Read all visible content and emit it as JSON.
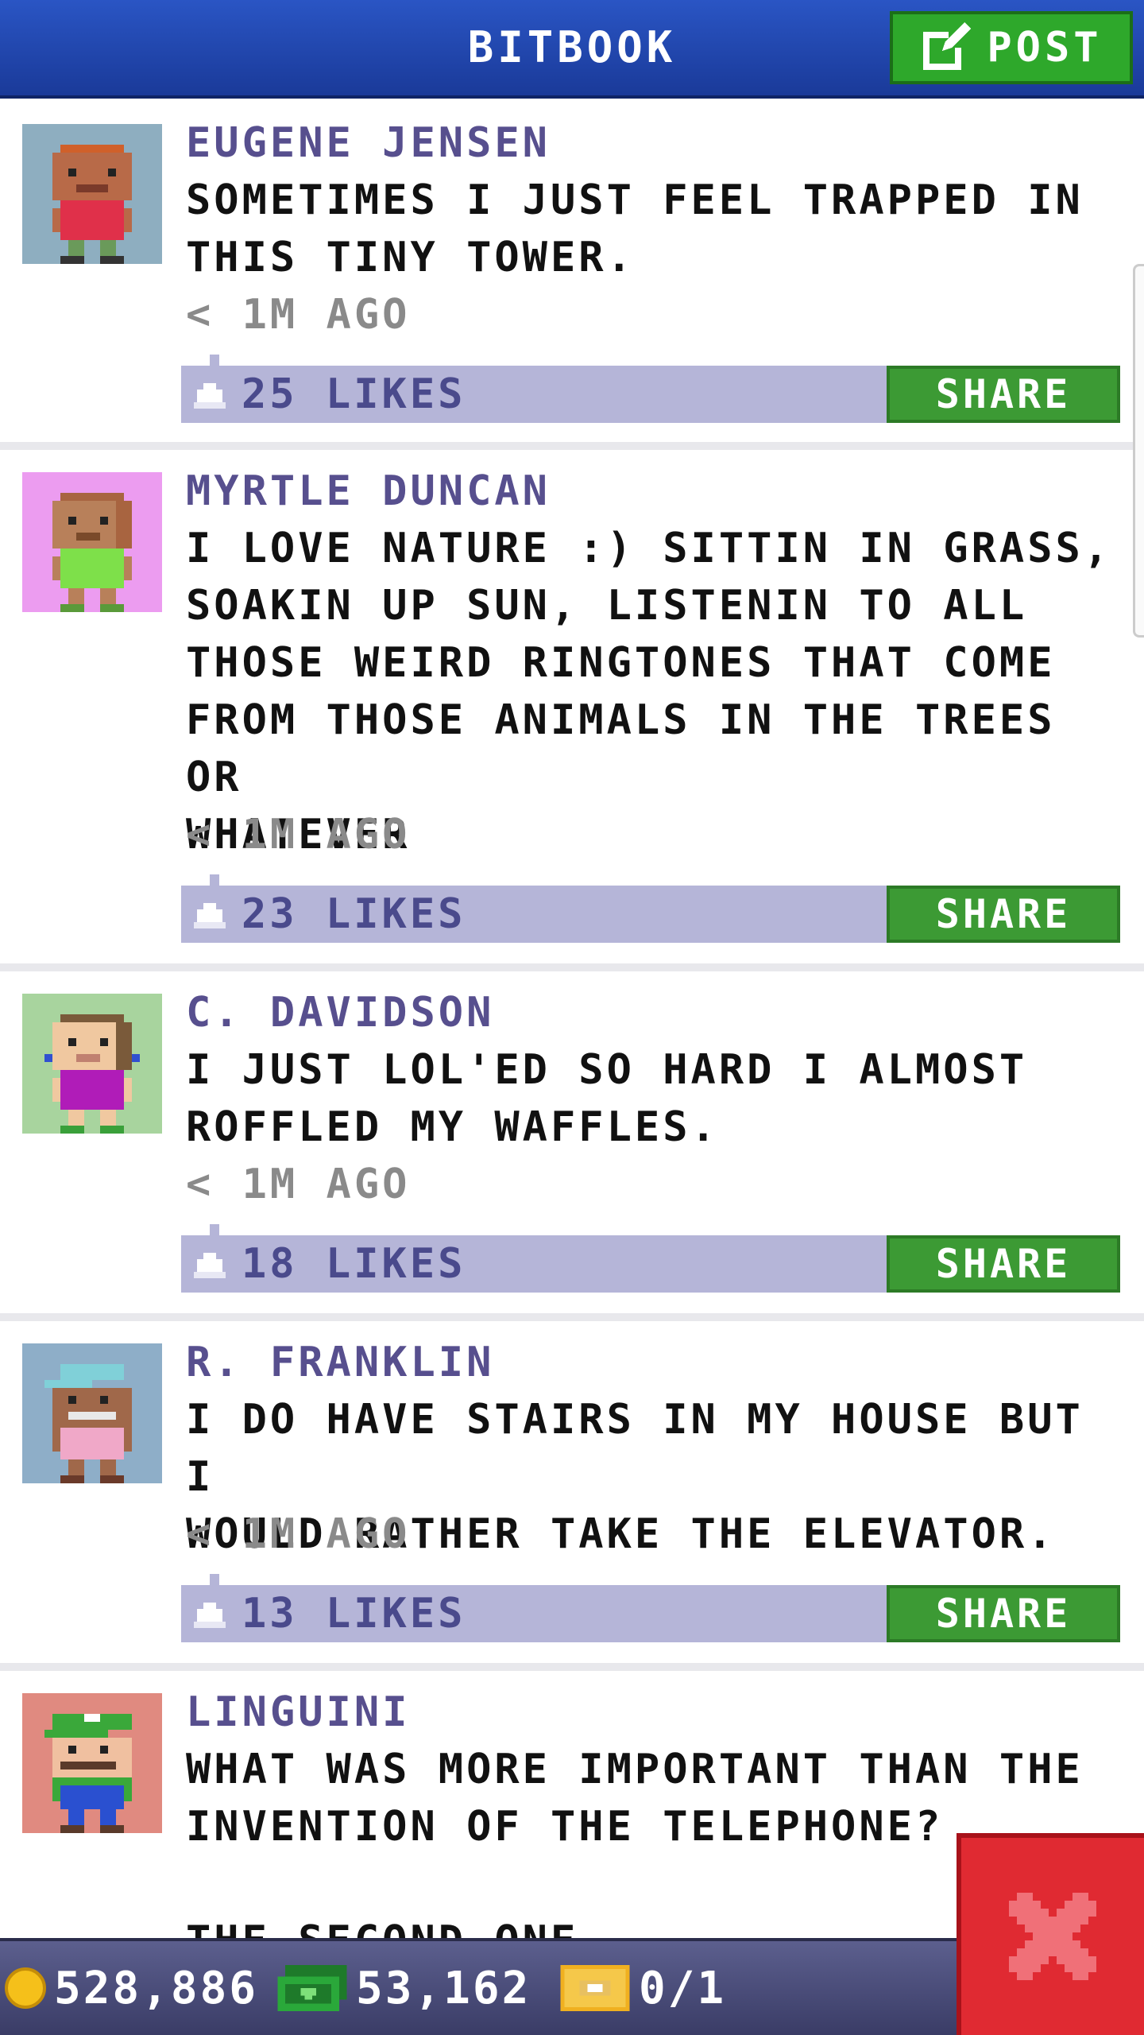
{
  "header": {
    "title": "BITBOOK",
    "post_label": "POST"
  },
  "posts": [
    {
      "author": "EUGENE JENSEN",
      "lines": [
        "SOMETIMES I JUST FEEL TRAPPED IN",
        "THIS TINY TOWER."
      ],
      "time": "< 1M AGO",
      "likes": "25 LIKES",
      "share_label": "SHARE",
      "avatar_bg": "#8eaec0",
      "shirt": "#e0304a",
      "skin": "#b86a48",
      "hair": "#d0602a"
    },
    {
      "author": "MYRTLE DUNCAN",
      "lines": [
        "I LOVE NATURE :) SITTIN IN GRASS,",
        "SOAKIN UP SUN, LISTENIN TO ALL",
        "THOSE WEIRD RINGTONES THAT COME",
        "FROM THOSE ANIMALS IN THE TREES OR",
        "WHATEVER"
      ],
      "time": "< 1M AGO",
      "likes": "23 LIKES",
      "share_label": "SHARE",
      "avatar_bg": "#ec9cf0",
      "shirt": "#7ee04a",
      "skin": "#b8805a",
      "hair": "#a86440"
    },
    {
      "author": "C. DAVIDSON",
      "lines": [
        "I JUST LOL'ED SO HARD I ALMOST",
        "ROFFLED MY WAFFLES."
      ],
      "time": "< 1M AGO",
      "likes": "18 LIKES",
      "share_label": "SHARE",
      "avatar_bg": "#a8d49e",
      "shirt": "#b01cb8",
      "skin": "#f0c8a0",
      "hair": "#7a5a3a"
    },
    {
      "author": "R. FRANKLIN",
      "lines": [
        "I DO HAVE STAIRS IN MY HOUSE BUT I",
        "WOULD RATHER TAKE THE ELEVATOR."
      ],
      "time": "< 1M AGO",
      "likes": "13 LIKES",
      "share_label": "SHARE",
      "avatar_bg": "#8eaec8",
      "shirt": "#f0a8c8",
      "skin": "#a0684a",
      "hair": "#80d0d8"
    },
    {
      "author": "LINGUINI",
      "lines": [
        "WHAT WAS MORE IMPORTANT THAN THE",
        "INVENTION OF THE TELEPHONE?",
        "",
        "THE SECOND ONE."
      ],
      "avatar_bg": "#e08a80",
      "shirt": "#2a50d0",
      "skin": "#f0c0a0",
      "hair": "#3aa83a"
    }
  ],
  "status": {
    "coins": "528,886",
    "bux": "53,162",
    "tickets": "0/1"
  },
  "colors": {
    "header": "#2a55c4",
    "accent_green": "#2ea82b",
    "likes_bar": "#b5b5d8",
    "close_red": "#e02a32"
  }
}
